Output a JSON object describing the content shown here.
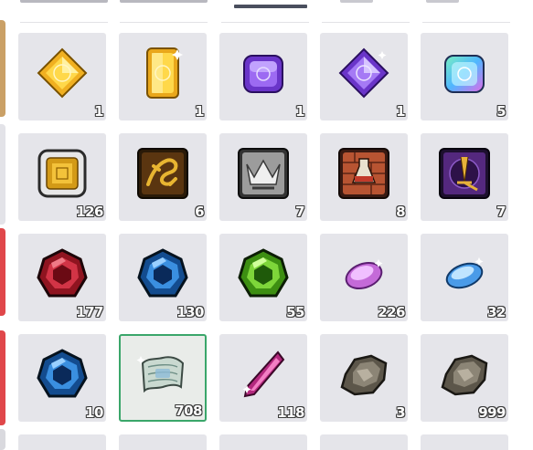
{
  "inventory": {
    "rows": [
      [
        {
          "name": "gold-diamond-gem",
          "qty": "1"
        },
        {
          "name": "gold-rectangle-gem",
          "qty": "1"
        },
        {
          "name": "purple-square-gem",
          "qty": "1"
        },
        {
          "name": "purple-diamond-gem",
          "qty": "1"
        },
        {
          "name": "rainbow-square-gem",
          "qty": "5"
        }
      ],
      [
        {
          "name": "gold-chip-plate",
          "qty": "126"
        },
        {
          "name": "dragon-gold-tile",
          "qty": "6"
        },
        {
          "name": "silver-crown-tile",
          "qty": "7"
        },
        {
          "name": "brick-potion-tile",
          "qty": "8"
        },
        {
          "name": "purple-sword-tile",
          "qty": "7"
        }
      ],
      [
        {
          "name": "red-ore",
          "qty": "177"
        },
        {
          "name": "blue-ore",
          "qty": "130"
        },
        {
          "name": "green-ore",
          "qty": "55"
        },
        {
          "name": "pink-crystal",
          "qty": "226"
        },
        {
          "name": "blue-crystal",
          "qty": "32"
        }
      ],
      [
        {
          "name": "blue-ore",
          "qty": "10"
        },
        {
          "name": "scroll",
          "qty": "708"
        },
        {
          "name": "magenta-shard",
          "qty": "118"
        },
        {
          "name": "ore-chunk",
          "qty": "3"
        },
        {
          "name": "ore-chunk",
          "qty": "999"
        }
      ]
    ],
    "selected_slot": "scroll"
  },
  "colors": {
    "slot_bg": "#e5e5ea",
    "selected_border": "#3aa66a",
    "tab_underline": "#4a4f5e",
    "edge_red": "#e0474a"
  }
}
